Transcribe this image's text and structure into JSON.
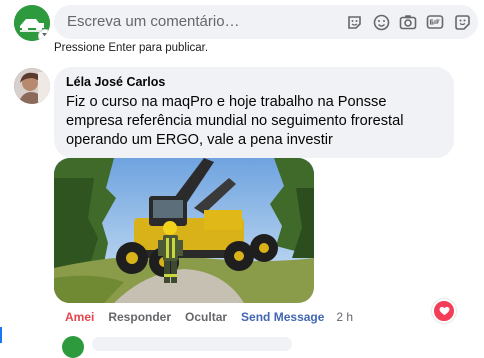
{
  "composer": {
    "placeholder": "Escreva um comentário…",
    "hint": "Pressione Enter para publicar.",
    "icons": [
      "sticker-icon",
      "emoji-icon",
      "camera-icon",
      "gif-icon",
      "avatar-sticker-icon"
    ]
  },
  "comment": {
    "author": "Léla José Carlos",
    "text": "Fiz o curso na maqPro e hoje trabalho na Ponsse empresa referência mundial no seguimento frorestal operando um ERGO, vale a pena investir",
    "actions": {
      "like": "Amei",
      "reply": "Responder",
      "hide": "Ocultar",
      "send_message": "Send Message",
      "time": "2 h"
    },
    "reaction": "love-icon"
  },
  "colors": {
    "bubble": "#f0f2f5",
    "like_active": "#e4464d",
    "link": "#4267b2",
    "brand_green": "#2e9a3e"
  }
}
